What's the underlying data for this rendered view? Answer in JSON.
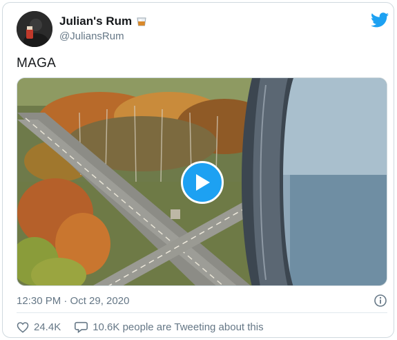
{
  "tweet": {
    "author_name": "Julian's Rum",
    "author_handle": "@JuliansRum",
    "text": "MAGA",
    "timestamp": "12:30 PM · Oct 29, 2020",
    "likes": "24.4K",
    "replies_text": "10.6K people are Tweeting about this"
  },
  "icons": {
    "name_emoji": "tumbler-glass-icon",
    "brand": "twitter-bird-icon",
    "play": "play-icon",
    "info": "info-icon",
    "like": "heart-icon",
    "reply": "speech-bubble-icon"
  },
  "colors": {
    "accent": "#1da1f2",
    "muted_text": "#657786",
    "border": "#cfd9de"
  }
}
